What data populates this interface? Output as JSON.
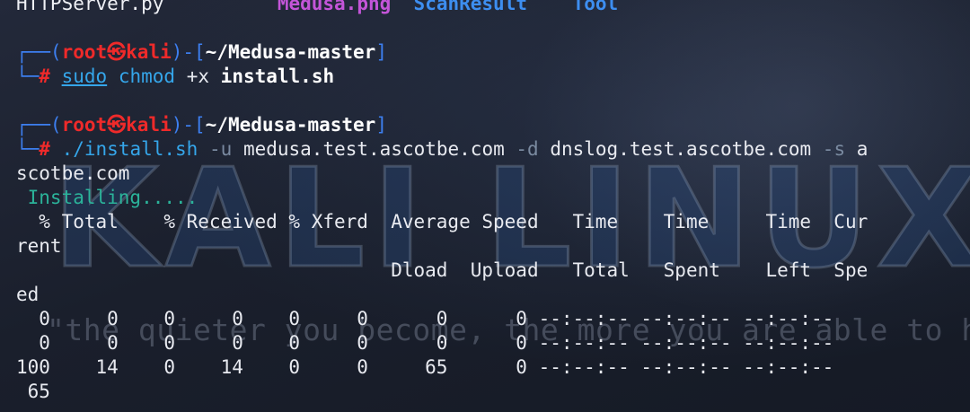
{
  "wallpaper": {
    "logo": "KALI LINUX",
    "quote": "\"the quieter you become, the more you are able to hear\""
  },
  "ls": {
    "file1": "HTTPServer.py",
    "file2": "Medusa.png",
    "dir1": "ScanResult",
    "dir2": "Tool"
  },
  "prompt1": {
    "frame_top": "┌──(",
    "user": "root㉿kali",
    "frame_mid": ")-[",
    "path": "~/Medusa-master",
    "frame_end": "]",
    "frame_bottom": "└─",
    "hash": "#",
    "cmd_sudo": "sudo",
    "cmd_chmod": "chmod",
    "arg1": "+x",
    "arg2": "install.sh"
  },
  "prompt2": {
    "frame_top": "┌──(",
    "user": "root㉿kali",
    "frame_mid": ")-[",
    "path": "~/Medusa-master",
    "frame_end": "]",
    "frame_bottom": "└─",
    "hash": "#",
    "cmd": "./install.sh",
    "opt_u": "-u",
    "val_u": "medusa.test.ascotbe.com",
    "opt_d": "-d",
    "val_d": "dnslog.test.ascotbe.com",
    "opt_s": "-s",
    "val_s_start": "a",
    "val_s_wrap": "scotbe.com"
  },
  "output": {
    "installing": " Installing.....",
    "header1": "  % Total    % Received % Xferd  Average Speed   Time    Time     Time  Cur",
    "header1_wrap": "rent",
    "header2": "                                 Dload  Upload   Total   Spent    Left  Spe",
    "header2_wrap": "ed",
    "row1": "  0     0    0     0    0     0      0      0 --:--:-- --:--:-- --:--:--",
    "row2": "  0     0    0     0    0     0      0      0 --:--:-- --:--:-- --:--:--",
    "row3": "100    14    0    14    0     0     65      0 --:--:-- --:--:-- --:--:--",
    "row3_wrap": " 65"
  }
}
